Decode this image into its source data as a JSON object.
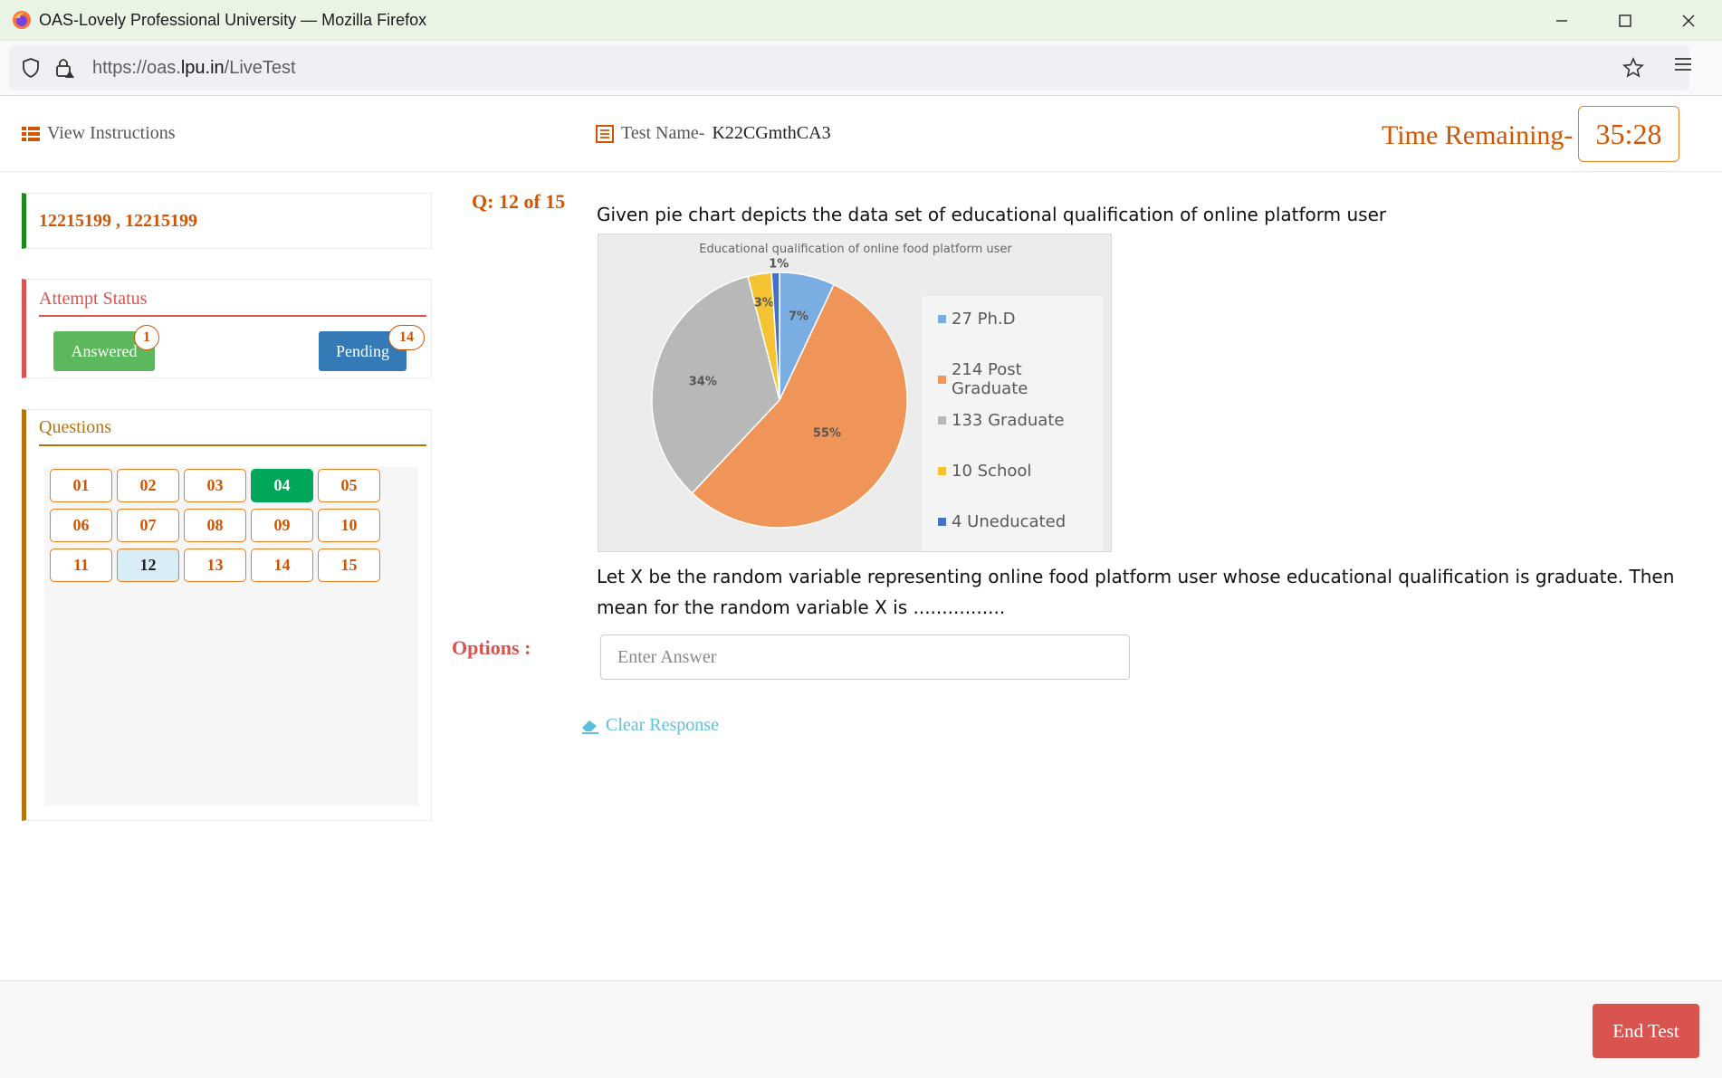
{
  "browser": {
    "window_title": "OAS-Lovely Professional University — Mozilla Firefox",
    "url_prefix": "https://oas.",
    "url_domain": "lpu.in",
    "url_path": "/LiveTest"
  },
  "header": {
    "view_instructions": "View Instructions",
    "test_name_label": "Test Name-",
    "test_name_value": "K22CGmthCA3",
    "time_label": "Time Remaining-",
    "time_value": "35:28"
  },
  "user": {
    "id_text": "12215199 , 12215199"
  },
  "attempt_status": {
    "title": "Attempt Status",
    "answered_label": "Answered",
    "answered_count": "1",
    "pending_label": "Pending",
    "pending_count": "14"
  },
  "questions_panel": {
    "title": "Questions",
    "items": [
      {
        "label": "01",
        "state": "default"
      },
      {
        "label": "02",
        "state": "default"
      },
      {
        "label": "03",
        "state": "default"
      },
      {
        "label": "04",
        "state": "answered"
      },
      {
        "label": "05",
        "state": "default"
      },
      {
        "label": "06",
        "state": "default"
      },
      {
        "label": "07",
        "state": "default"
      },
      {
        "label": "08",
        "state": "default"
      },
      {
        "label": "09",
        "state": "default"
      },
      {
        "label": "10",
        "state": "default"
      },
      {
        "label": "11",
        "state": "default"
      },
      {
        "label": "12",
        "state": "current"
      },
      {
        "label": "13",
        "state": "default"
      },
      {
        "label": "14",
        "state": "default"
      },
      {
        "label": "15",
        "state": "default"
      }
    ]
  },
  "question": {
    "number": "Q: 12 of 15",
    "text_line1": "Given pie chart depicts the data set of  educational qualification of online platform user",
    "text_line2": "Let X be the random variable representing online food platform user whose educational qualification is  graduate. Then mean for the random variable X is ................",
    "options_label": "Options :",
    "answer_placeholder": "Enter Answer",
    "clear_response": "Clear Response"
  },
  "chart_data": {
    "type": "pie",
    "title": "Educational qualification of  online food platform user",
    "slices": [
      {
        "label": "27 Ph.D",
        "percent_label": "7%",
        "value": 7,
        "color": "#7aaee2"
      },
      {
        "label": "214 Post Graduate",
        "percent_label": "55%",
        "value": 55,
        "color": "#f0955a"
      },
      {
        "label": "133 Graduate",
        "percent_label": "34%",
        "value": 34,
        "color": "#b8b8b8"
      },
      {
        "label": "10 School",
        "percent_label": "3%",
        "value": 3,
        "color": "#f5c333"
      },
      {
        "label": "4 Uneducated",
        "percent_label": "1%",
        "value": 1,
        "color": "#4472c4"
      }
    ],
    "legend_position": "right"
  },
  "footer": {
    "end_test": "End Test"
  },
  "colors": {
    "accent": "#d35400",
    "answered": "#00a65a",
    "pending": "#337ab7",
    "danger": "#d9534f"
  }
}
